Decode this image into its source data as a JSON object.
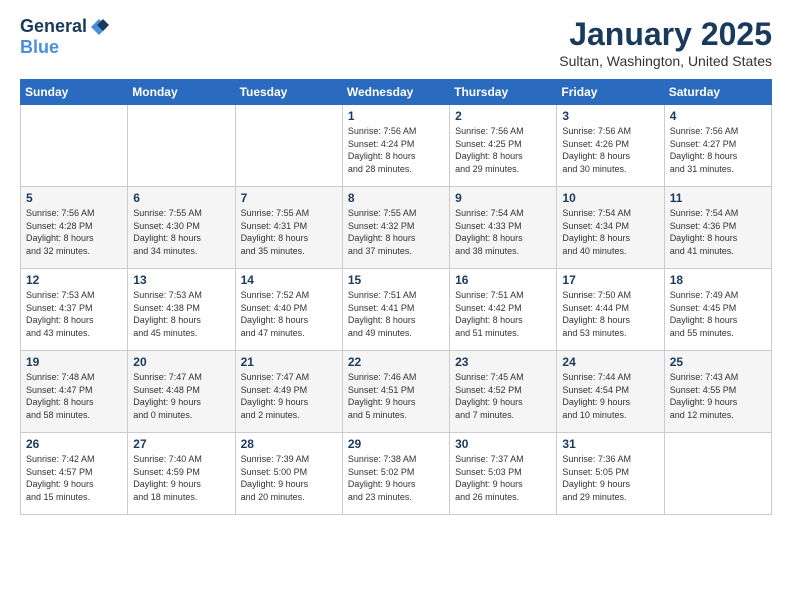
{
  "logo": {
    "general": "General",
    "blue": "Blue"
  },
  "title": "January 2025",
  "location": "Sultan, Washington, United States",
  "days_header": [
    "Sunday",
    "Monday",
    "Tuesday",
    "Wednesday",
    "Thursday",
    "Friday",
    "Saturday"
  ],
  "weeks": [
    [
      {
        "day": "",
        "info": ""
      },
      {
        "day": "",
        "info": ""
      },
      {
        "day": "",
        "info": ""
      },
      {
        "day": "1",
        "info": "Sunrise: 7:56 AM\nSunset: 4:24 PM\nDaylight: 8 hours\nand 28 minutes."
      },
      {
        "day": "2",
        "info": "Sunrise: 7:56 AM\nSunset: 4:25 PM\nDaylight: 8 hours\nand 29 minutes."
      },
      {
        "day": "3",
        "info": "Sunrise: 7:56 AM\nSunset: 4:26 PM\nDaylight: 8 hours\nand 30 minutes."
      },
      {
        "day": "4",
        "info": "Sunrise: 7:56 AM\nSunset: 4:27 PM\nDaylight: 8 hours\nand 31 minutes."
      }
    ],
    [
      {
        "day": "5",
        "info": "Sunrise: 7:56 AM\nSunset: 4:28 PM\nDaylight: 8 hours\nand 32 minutes."
      },
      {
        "day": "6",
        "info": "Sunrise: 7:55 AM\nSunset: 4:30 PM\nDaylight: 8 hours\nand 34 minutes."
      },
      {
        "day": "7",
        "info": "Sunrise: 7:55 AM\nSunset: 4:31 PM\nDaylight: 8 hours\nand 35 minutes."
      },
      {
        "day": "8",
        "info": "Sunrise: 7:55 AM\nSunset: 4:32 PM\nDaylight: 8 hours\nand 37 minutes."
      },
      {
        "day": "9",
        "info": "Sunrise: 7:54 AM\nSunset: 4:33 PM\nDaylight: 8 hours\nand 38 minutes."
      },
      {
        "day": "10",
        "info": "Sunrise: 7:54 AM\nSunset: 4:34 PM\nDaylight: 8 hours\nand 40 minutes."
      },
      {
        "day": "11",
        "info": "Sunrise: 7:54 AM\nSunset: 4:36 PM\nDaylight: 8 hours\nand 41 minutes."
      }
    ],
    [
      {
        "day": "12",
        "info": "Sunrise: 7:53 AM\nSunset: 4:37 PM\nDaylight: 8 hours\nand 43 minutes."
      },
      {
        "day": "13",
        "info": "Sunrise: 7:53 AM\nSunset: 4:38 PM\nDaylight: 8 hours\nand 45 minutes."
      },
      {
        "day": "14",
        "info": "Sunrise: 7:52 AM\nSunset: 4:40 PM\nDaylight: 8 hours\nand 47 minutes."
      },
      {
        "day": "15",
        "info": "Sunrise: 7:51 AM\nSunset: 4:41 PM\nDaylight: 8 hours\nand 49 minutes."
      },
      {
        "day": "16",
        "info": "Sunrise: 7:51 AM\nSunset: 4:42 PM\nDaylight: 8 hours\nand 51 minutes."
      },
      {
        "day": "17",
        "info": "Sunrise: 7:50 AM\nSunset: 4:44 PM\nDaylight: 8 hours\nand 53 minutes."
      },
      {
        "day": "18",
        "info": "Sunrise: 7:49 AM\nSunset: 4:45 PM\nDaylight: 8 hours\nand 55 minutes."
      }
    ],
    [
      {
        "day": "19",
        "info": "Sunrise: 7:48 AM\nSunset: 4:47 PM\nDaylight: 8 hours\nand 58 minutes."
      },
      {
        "day": "20",
        "info": "Sunrise: 7:47 AM\nSunset: 4:48 PM\nDaylight: 9 hours\nand 0 minutes."
      },
      {
        "day": "21",
        "info": "Sunrise: 7:47 AM\nSunset: 4:49 PM\nDaylight: 9 hours\nand 2 minutes."
      },
      {
        "day": "22",
        "info": "Sunrise: 7:46 AM\nSunset: 4:51 PM\nDaylight: 9 hours\nand 5 minutes."
      },
      {
        "day": "23",
        "info": "Sunrise: 7:45 AM\nSunset: 4:52 PM\nDaylight: 9 hours\nand 7 minutes."
      },
      {
        "day": "24",
        "info": "Sunrise: 7:44 AM\nSunset: 4:54 PM\nDaylight: 9 hours\nand 10 minutes."
      },
      {
        "day": "25",
        "info": "Sunrise: 7:43 AM\nSunset: 4:55 PM\nDaylight: 9 hours\nand 12 minutes."
      }
    ],
    [
      {
        "day": "26",
        "info": "Sunrise: 7:42 AM\nSunset: 4:57 PM\nDaylight: 9 hours\nand 15 minutes."
      },
      {
        "day": "27",
        "info": "Sunrise: 7:40 AM\nSunset: 4:59 PM\nDaylight: 9 hours\nand 18 minutes."
      },
      {
        "day": "28",
        "info": "Sunrise: 7:39 AM\nSunset: 5:00 PM\nDaylight: 9 hours\nand 20 minutes."
      },
      {
        "day": "29",
        "info": "Sunrise: 7:38 AM\nSunset: 5:02 PM\nDaylight: 9 hours\nand 23 minutes."
      },
      {
        "day": "30",
        "info": "Sunrise: 7:37 AM\nSunset: 5:03 PM\nDaylight: 9 hours\nand 26 minutes."
      },
      {
        "day": "31",
        "info": "Sunrise: 7:36 AM\nSunset: 5:05 PM\nDaylight: 9 hours\nand 29 minutes."
      },
      {
        "day": "",
        "info": ""
      }
    ]
  ]
}
